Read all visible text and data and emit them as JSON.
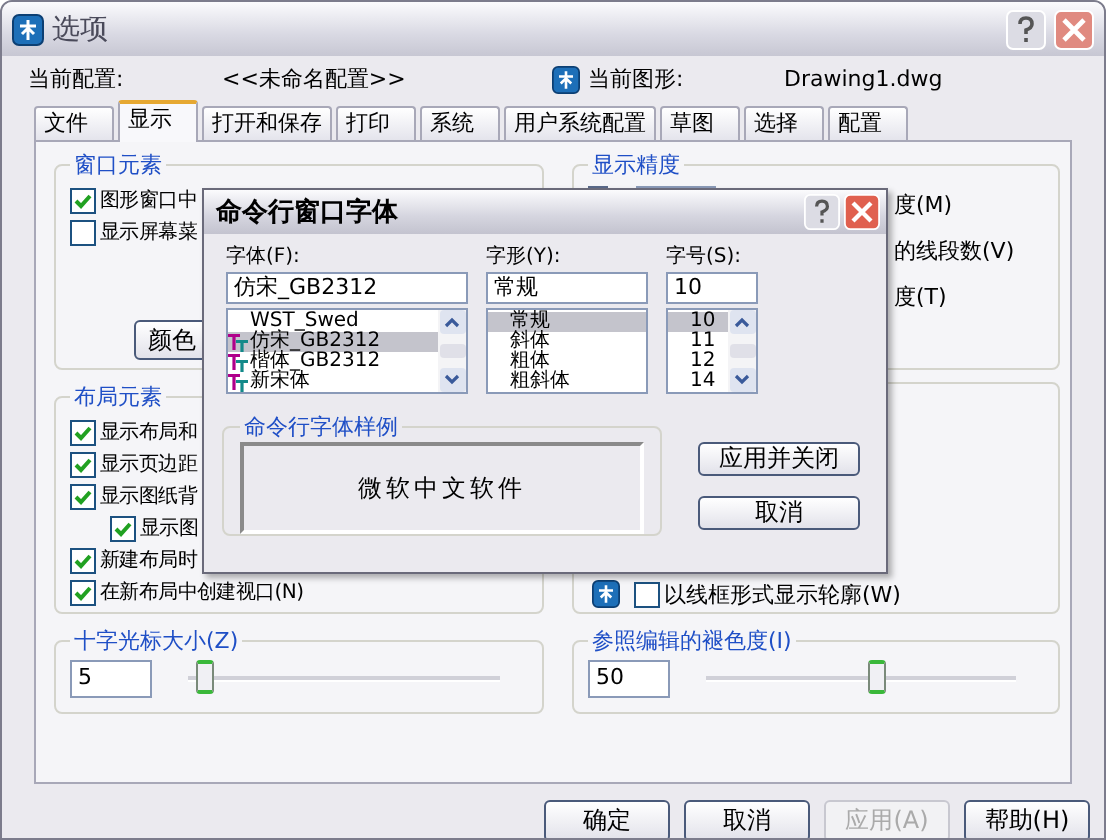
{
  "window": {
    "title": "选项"
  },
  "profile": {
    "label": "当前配置:",
    "value": "<<未命名配置>>"
  },
  "drawing": {
    "label": "当前图形:",
    "value": "Drawing1.dwg"
  },
  "tabs": [
    {
      "label": "文件",
      "selected": false
    },
    {
      "label": "显示",
      "selected": true
    },
    {
      "label": "打开和保存",
      "selected": false
    },
    {
      "label": "打印",
      "selected": false
    },
    {
      "label": "系统",
      "selected": false
    },
    {
      "label": "用户系统配置",
      "selected": false
    },
    {
      "label": "草图",
      "selected": false
    },
    {
      "label": "选择",
      "selected": false
    },
    {
      "label": "配置",
      "selected": false
    }
  ],
  "window_elements": {
    "title": "窗口元素",
    "checkboxes": [
      {
        "label": "图形窗口中",
        "checked": true
      },
      {
        "label": "显示屏幕菜",
        "checked": false
      }
    ],
    "button": "颜色"
  },
  "layout_elements": {
    "title": "布局元素",
    "checkboxes": [
      {
        "label": "显示布局和",
        "checked": true
      },
      {
        "label": "显示页边距",
        "checked": true
      },
      {
        "label": "显示图纸背",
        "checked": true,
        "children": [
          {
            "label": "显示图",
            "checked": true
          }
        ]
      },
      {
        "label": "新建布局时",
        "checked": true
      },
      {
        "label": "在新布局中创建视口(N)",
        "checked": true
      }
    ]
  },
  "crosshair": {
    "title": "十字光标大小(Z)",
    "value": "5",
    "level": 0.05
  },
  "display_resolution": {
    "title": "显示精度",
    "labels": [
      "度(M)",
      "的线段数(V)",
      "度(T)"
    ]
  },
  "display_performance": {
    "checkbox": {
      "label": "以线框形式显示轮廓(W)",
      "checked": false
    }
  },
  "fade": {
    "title": "参照编辑的褪色度(I)",
    "value": "50",
    "level": 0.55
  },
  "buttons": [
    {
      "label": "确定",
      "disabled": false
    },
    {
      "label": "取消",
      "disabled": false
    },
    {
      "label": "应用(A)",
      "disabled": true
    },
    {
      "label": "帮助(H)",
      "disabled": false
    }
  ],
  "font_dialog": {
    "title": "命令行窗口字体",
    "columns": [
      {
        "label": "字体(F):",
        "value": "仿宋_GB2312",
        "scrollbar": true,
        "items": [
          {
            "label": "WST_Swed",
            "truetype": false,
            "selected": false
          },
          {
            "label": "仿宋_GB2312",
            "truetype": true,
            "selected": true
          },
          {
            "label": "楷体_GB2312",
            "truetype": true,
            "selected": false
          },
          {
            "label": "新宋体",
            "truetype": true,
            "selected": false
          }
        ]
      },
      {
        "label": "字形(Y):",
        "value": "常规",
        "scrollbar": false,
        "items": [
          {
            "label": "常规",
            "truetype": false,
            "selected": true
          },
          {
            "label": "斜体",
            "truetype": false,
            "selected": false
          },
          {
            "label": "粗体",
            "truetype": false,
            "selected": false
          },
          {
            "label": "粗斜体",
            "truetype": false,
            "selected": false
          }
        ]
      },
      {
        "label": "字号(S):",
        "value": "10",
        "scrollbar": true,
        "items": [
          {
            "label": "10",
            "truetype": false,
            "selected": true
          },
          {
            "label": "11",
            "truetype": false,
            "selected": false
          },
          {
            "label": "12",
            "truetype": false,
            "selected": false
          },
          {
            "label": "14",
            "truetype": false,
            "selected": false
          }
        ]
      }
    ],
    "sample": {
      "title": "命令行字体样例",
      "text": "微软中文软件"
    },
    "buttons": [
      "应用并关闭",
      "取消"
    ]
  }
}
